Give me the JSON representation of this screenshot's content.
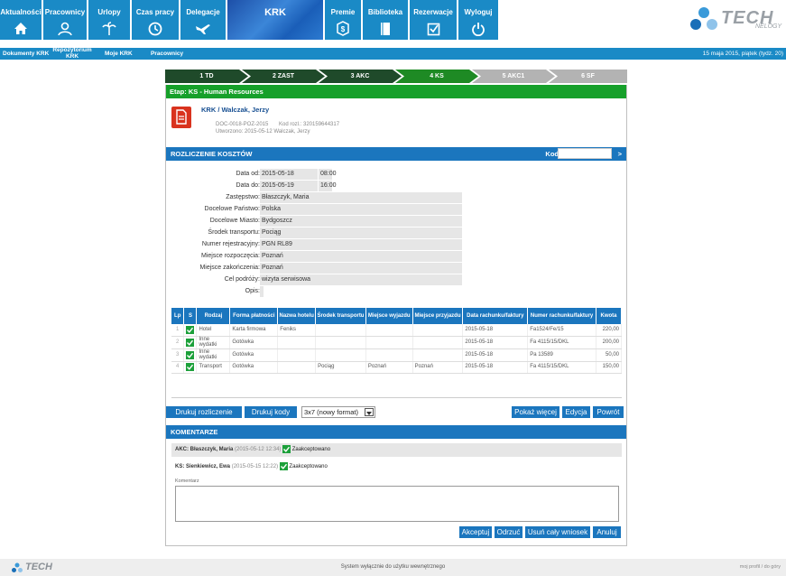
{
  "nav": {
    "items": [
      {
        "label": "Aktualności",
        "icon": "home-icon"
      },
      {
        "label": "Pracownicy",
        "icon": "people-icon"
      },
      {
        "label": "Urlopy",
        "icon": "palm-icon"
      },
      {
        "label": "Czas pracy",
        "icon": "clock-icon"
      },
      {
        "label": "Delegacje",
        "icon": "plane-icon"
      },
      {
        "label": "KRK",
        "icon": "krk-banner"
      },
      {
        "label": "Premie",
        "icon": "dollar-icon"
      },
      {
        "label": "Biblioteka",
        "icon": "book-icon"
      },
      {
        "label": "Rezerwacje",
        "icon": "checkbox-icon"
      },
      {
        "label": "Wyloguj",
        "icon": "power-icon"
      }
    ],
    "brand": {
      "text": "TECH",
      "sub": "NELOGY"
    }
  },
  "subnav": {
    "items": [
      "Dokumenty KRK",
      "Repozytorium KRK",
      "Moje KRK",
      "Pracownicy"
    ],
    "date": "15 maja 2015, piątek (tydz. 20)"
  },
  "steps": [
    "1 TD",
    "2 ZAST",
    "3 AKC",
    "4 KS",
    "5 AKC1",
    "6 SF"
  ],
  "etap": "Etap: KS - Human Resources",
  "doc": {
    "title_prefix": "KRK / ",
    "title_name": "Walczak, Jerzy",
    "number": "DOC-0018-POZ-2015",
    "kod_rozl": "Kod rozl.: 320159644317",
    "created": "Utworzono: 2015-05-12 Walczak, Jerzy"
  },
  "section_costs": {
    "title": "ROZLICZENIE KOSZTÓW",
    "kod_label": "Kod",
    "go": ">"
  },
  "fields": [
    {
      "label": "Data od:",
      "value": "2015-05-18",
      "time": "08:00"
    },
    {
      "label": "Data do:",
      "value": "2015-05-19",
      "time": "16:00"
    },
    {
      "label": "Zastępstwo:",
      "value": "Błaszczyk, Maria"
    },
    {
      "label": "Docelowe Państwo:",
      "value": "Polska"
    },
    {
      "label": "Docelowe Miasto:",
      "value": "Bydgoszcz"
    },
    {
      "label": "Środek transportu:",
      "value": "Pociąg"
    },
    {
      "label": "Numer rejestracyjny:",
      "value": "PGN RL89"
    },
    {
      "label": "Miejsce rozpoczęcia:",
      "value": "Poznań"
    },
    {
      "label": "Miejsce zakończenia:",
      "value": "Poznań"
    },
    {
      "label": "Cel podróży:",
      "value": "wizyta serwisowa"
    },
    {
      "label": "Opis:",
      "value": ""
    }
  ],
  "table": {
    "headers": [
      "Lp",
      "S",
      "Rodzaj",
      "Forma płatności",
      "Nazwa hotelu",
      "Środek transportu",
      "Miejsce wyjazdu",
      "Miejsce przyjazdu",
      "Data rachunku/faktury",
      "Numer rachunku/faktury",
      "Kwota"
    ],
    "rows": [
      [
        "1",
        "",
        "Hotel",
        "Karta firmowa",
        "Feniks",
        "",
        "",
        "",
        "2015-05-18",
        "Fa1524/Fe/15",
        "220,00"
      ],
      [
        "2",
        "",
        "Inne wydatki",
        "Gotówka",
        "",
        "",
        "",
        "",
        "2015-05-18",
        "Fa 4115/15/DKL",
        "200,00"
      ],
      [
        "3",
        "",
        "Inne wydatki",
        "Gotówka",
        "",
        "",
        "",
        "",
        "2015-05-18",
        "Pa 13589",
        "50,00"
      ],
      [
        "4",
        "",
        "Transport",
        "Gotówka",
        "",
        "Pociąg",
        "Poznań",
        "Poznań",
        "2015-05-18",
        "Fa 4115/15/DKL",
        "150,00"
      ]
    ]
  },
  "buttons": {
    "print_settlement": "Drukuj rozliczenie",
    "print_codes": "Drukuj kody",
    "format_selected": "3x7 (nowy format)",
    "show_more": "Pokaż więcej",
    "edit": "Edycja",
    "back": "Powrót",
    "accept": "Akceptuj",
    "reject": "Odrzuć",
    "delete_all": "Usuń cały wniosek",
    "cancel": "Anuluj"
  },
  "comments": {
    "title": "KOMENTARZE",
    "entries": [
      {
        "who": "AKC: Błaszczyk, Maria",
        "when": "(2015-05-12 12:34)",
        "status": "Zaakceptowano"
      },
      {
        "who": "KS: Sienkiewicz, Ewa",
        "when": "(2015-05-15 12:22)",
        "status": "Zaakceptowano"
      }
    ],
    "field_label": "Komentarz"
  },
  "footer": {
    "text": "System wyłącznie do użytku wewnętrznego",
    "links": "moj profil  /  do góry",
    "logo": "TECH"
  },
  "colors": {
    "nav_blue": "#1a8ac6",
    "bar_blue": "#1b76be",
    "stage_green": "#16a02a",
    "step_dark": "#1f4a2a",
    "step_current": "#1e8a24",
    "step_future": "#b3b3b3",
    "doc_red": "#d9331e"
  }
}
